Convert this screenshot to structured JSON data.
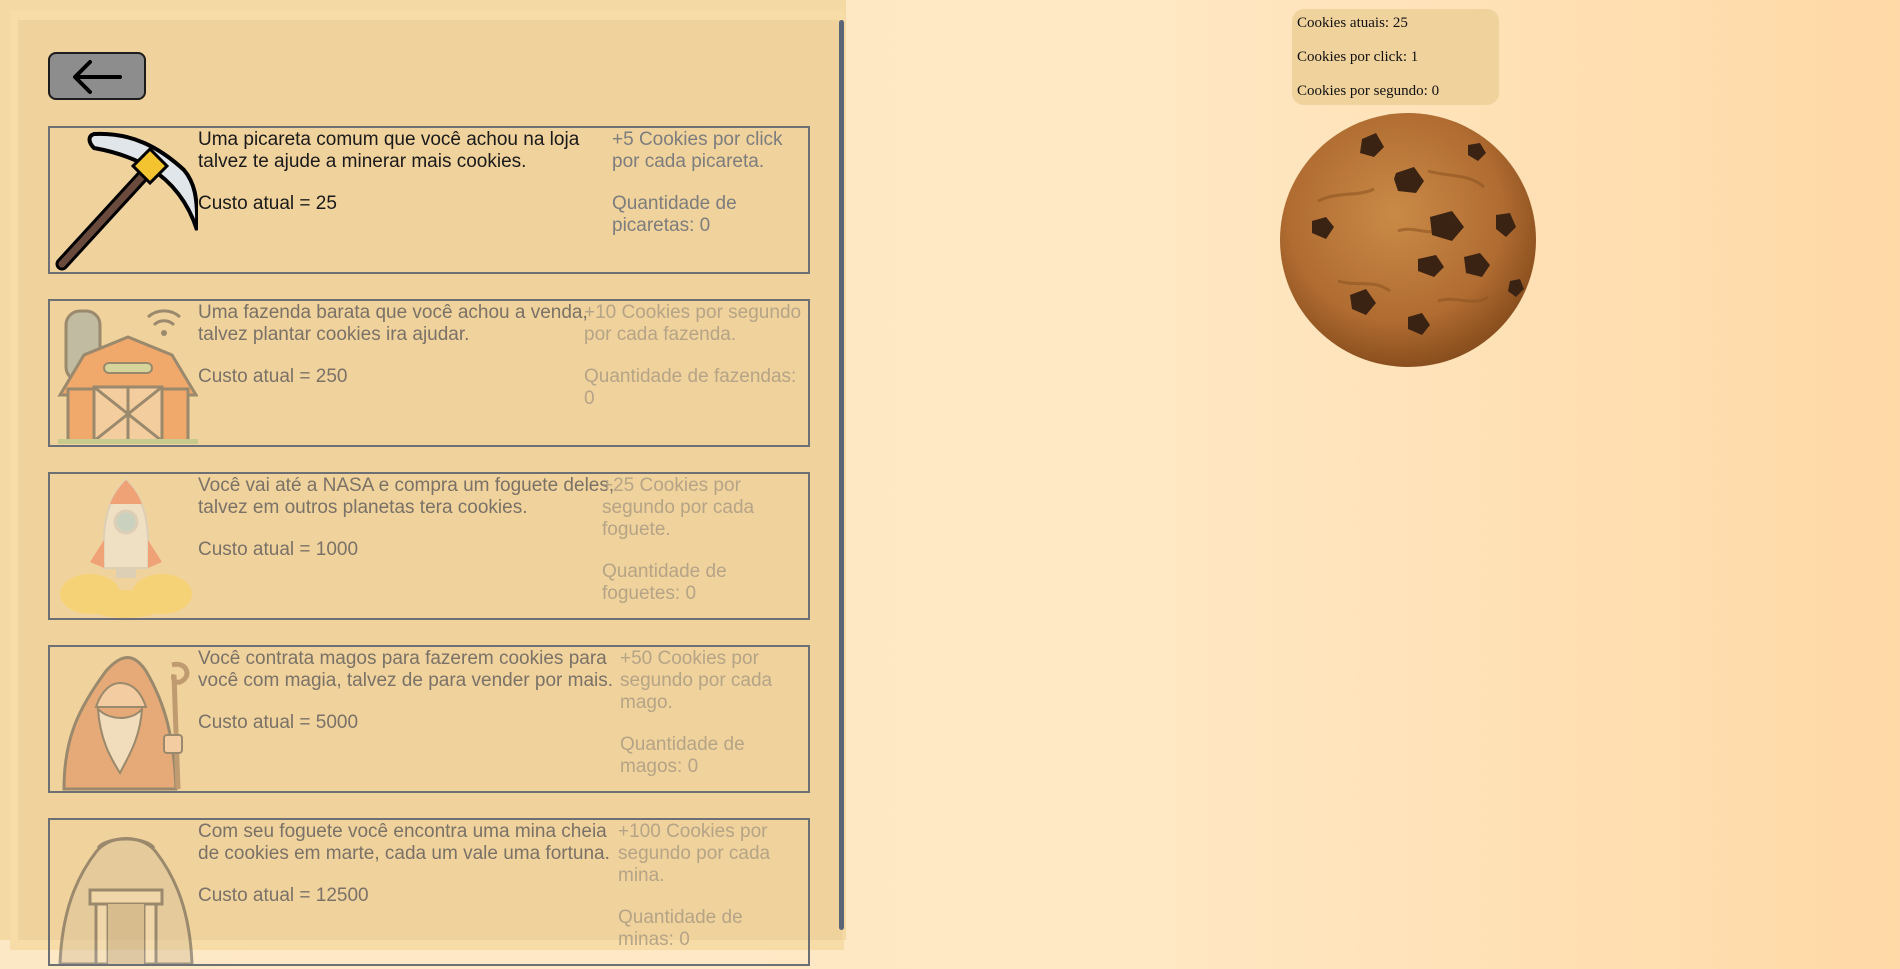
{
  "stats": {
    "current_label": "Cookies atuais: 25",
    "per_click_label": "Cookies por click: 1",
    "per_second_label": "Cookies por segundo: 0"
  },
  "shop": {
    "back_icon": "arrow-left-icon",
    "items": [
      {
        "icon": "pickaxe-icon",
        "description": "Uma picareta comum que você achou na loja talvez te ajude a minerar mais cookies.",
        "cost": "Custo atual = 25",
        "bonus": "+5 Cookies por click por cada picareta.",
        "quantity": "Quantidade de picaretas: 0",
        "affordable": true
      },
      {
        "icon": "farm-icon",
        "description": "Uma fazenda barata que você achou a venda, talvez plantar cookies ira ajudar.",
        "cost": "Custo atual = 250",
        "bonus": "+10 Cookies por segundo por cada fazenda.",
        "quantity": "Quantidade de fazendas: 0",
        "affordable": false
      },
      {
        "icon": "rocket-icon",
        "description": "Você vai até a NASA e compra um foguete deles, talvez em outros planetas tera cookies.",
        "cost": "Custo atual = 1000",
        "bonus": "+25 Cookies por segundo por cada foguete.",
        "quantity": "Quantidade de foguetes: 0",
        "affordable": false
      },
      {
        "icon": "wizard-icon",
        "description": "Você contrata magos para fazerem cookies para você com magia, talvez de para vender por mais.",
        "cost": "Custo atual = 5000",
        "bonus": "+50 Cookies por segundo por cada mago.",
        "quantity": "Quantidade de magos: 0",
        "affordable": false
      },
      {
        "icon": "mine-icon",
        "description": "Com seu foguete você encontra uma mina cheia de cookies em marte, cada um vale uma fortuna.",
        "cost": "Custo atual = 12500",
        "bonus": "+100 Cookies por segundo por cada mina.",
        "quantity": "Quantidade de minas: 0",
        "affordable": false
      }
    ]
  },
  "cookie": {
    "icon": "cookie-icon"
  },
  "colors": {
    "panel": "#f0d29d",
    "background": "#ffe8c4",
    "border": "#6c6f73",
    "button": "#8d8d8d"
  }
}
